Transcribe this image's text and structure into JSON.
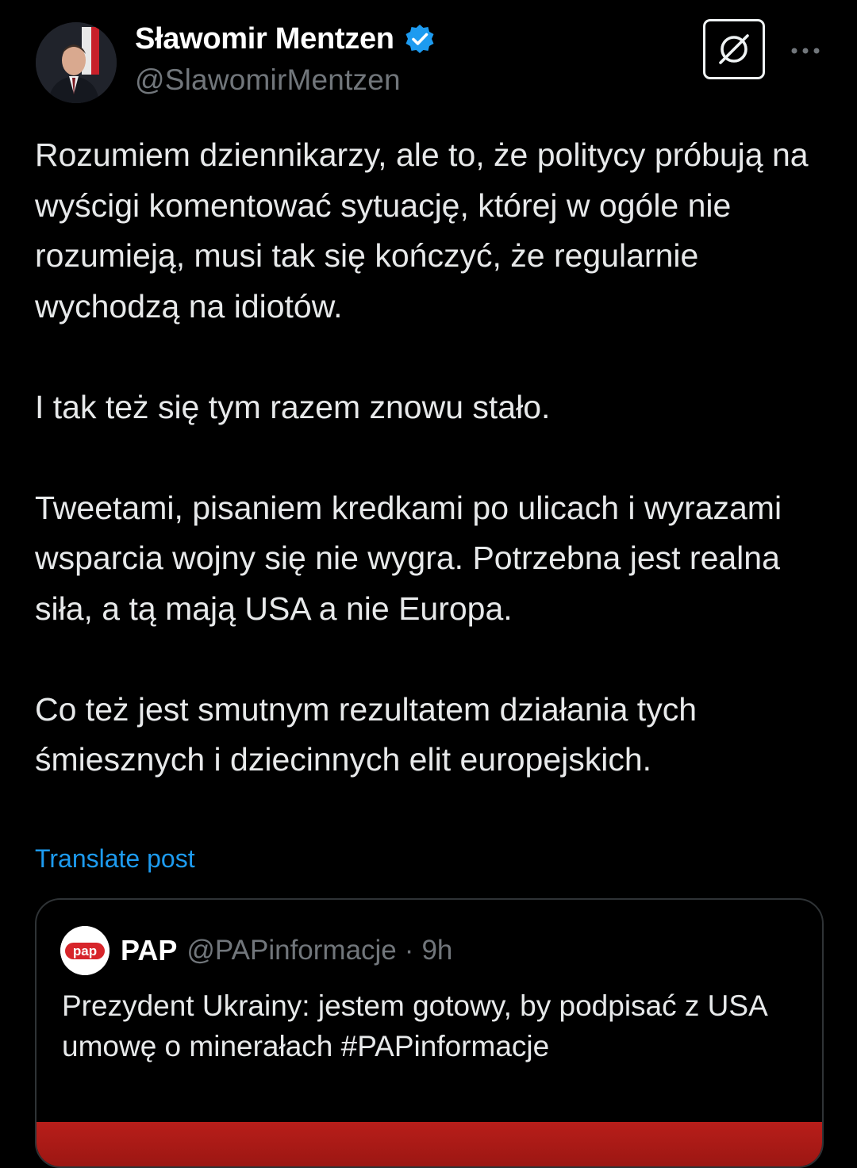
{
  "post": {
    "author": {
      "name": "Sławomir Mentzen",
      "handle": "@SlawomirMentzen",
      "verified": true,
      "verified_color": "#1d9bf0"
    },
    "actions": {
      "grok_icon": "grok-icon",
      "more_icon": "more-dots-icon"
    },
    "body": [
      "Rozumiem dziennikarzy, ale to, że politycy próbują na wyścigi komentować sytuację, której w ogóle nie rozumieją, musi tak się kończyć, że regularnie wychodzą na idiotów.",
      "I tak też się tym razem znowu stało.",
      "Tweetami, pisaniem kredkami po ulicach i wyrazami wsparcia wojny się nie wygra. Potrzebna jest realna siła, a tą mają USA a nie Europa.",
      "Co też jest smutnym rezultatem działania tych śmiesznych i dziecinnych elit europejskich."
    ],
    "translate_label": "Translate post",
    "link_color": "#1d9bf0"
  },
  "quote": {
    "avatar_text": "pap",
    "name": "PAP",
    "handle": "@PAPinformacje",
    "separator": "·",
    "time": "9h",
    "text": "Prezydent Ukrainy: jestem gotowy, by podpisać z USA umowę o minerałach #PAPinformacje",
    "brand_color": "#d7252b"
  }
}
